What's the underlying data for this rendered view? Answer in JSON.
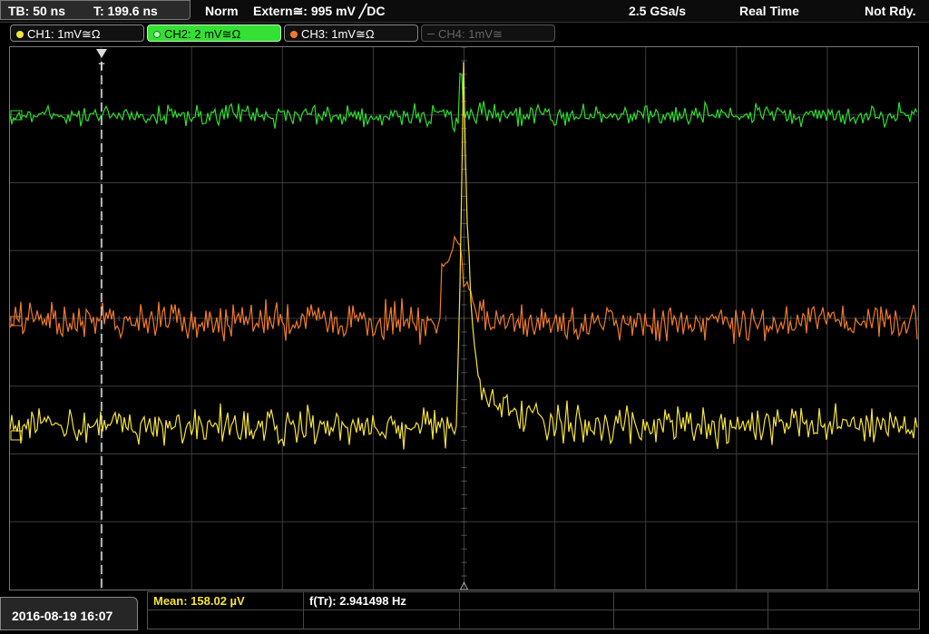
{
  "status": {
    "timebase": "TB: 50 ns",
    "trigger_time": "T: 199.6 ns",
    "mode": "Norm",
    "trigger_source": "Extern≅: 995 mV ╱DC",
    "sample_rate": "2.5 GSa/s",
    "acq_mode": "Real Time",
    "state": "Not Rdy."
  },
  "channels": [
    {
      "label": "CH1: 1mV≅Ω",
      "color": "#f5e33a",
      "active": true
    },
    {
      "label": "CH2: 2 mV≅Ω",
      "color": "#2fdc2f",
      "active": true,
      "selected": true
    },
    {
      "label": "CH3: 1mV≅Ω",
      "color": "#f07a2a",
      "active": true
    },
    {
      "label": "CH4: 1mV≅",
      "color": "#777777",
      "active": false
    }
  ],
  "trigger_marker": "T",
  "measurements": {
    "mean": "Mean: 158.02 µV",
    "freq": "f(Tr): 2.941498 Hz"
  },
  "datetime": "2016-08-19 16:07",
  "colors": {
    "ch1": "#f5e33a",
    "ch2": "#2fdc2f",
    "ch3": "#f07a2a",
    "grid": "#3c3c3c",
    "background": "#000000"
  }
}
